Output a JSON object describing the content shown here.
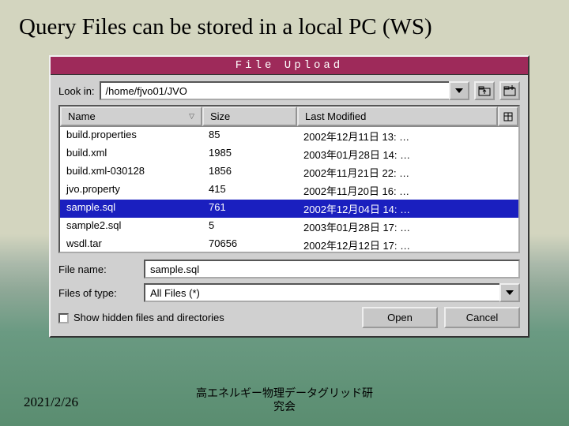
{
  "slide_title": "Query Files can be stored in a local PC (WS)",
  "dialog": {
    "title": "File Upload",
    "lookin_label": "Look in:",
    "path": "/home/fjvo01/JVO",
    "columns": {
      "name": "Name",
      "size": "Size",
      "modified": "Last Modified"
    },
    "files": [
      {
        "name": "build.properties",
        "size": "85",
        "modified": "2002年12月11日 13: …",
        "selected": false
      },
      {
        "name": "build.xml",
        "size": "1985",
        "modified": "2003年01月28日 14: …",
        "selected": false
      },
      {
        "name": "build.xml-030128",
        "size": "1856",
        "modified": "2002年11月21日 22: …",
        "selected": false
      },
      {
        "name": "jvo.property",
        "size": "415",
        "modified": "2002年11月20日 16: …",
        "selected": false
      },
      {
        "name": "sample.sql",
        "size": "761",
        "modified": "2002年12月04日 14: …",
        "selected": true
      },
      {
        "name": "sample2.sql",
        "size": "5",
        "modified": "2003年01月28日 17: …",
        "selected": false
      },
      {
        "name": "wsdl.tar",
        "size": "70656",
        "modified": "2002年12月12日 17: …",
        "selected": false
      }
    ],
    "filename_label": "File name:",
    "filename_value": "sample.sql",
    "filetype_label": "Files of type:",
    "filetype_value": "All Files (*)",
    "show_hidden_label": "Show hidden files and directories",
    "show_hidden_checked": false,
    "open_label": "Open",
    "cancel_label": "Cancel"
  },
  "footer": {
    "date": "2021/2/26",
    "org_line1": "高エネルギー物理データグリッド研",
    "org_line2": "究会"
  }
}
